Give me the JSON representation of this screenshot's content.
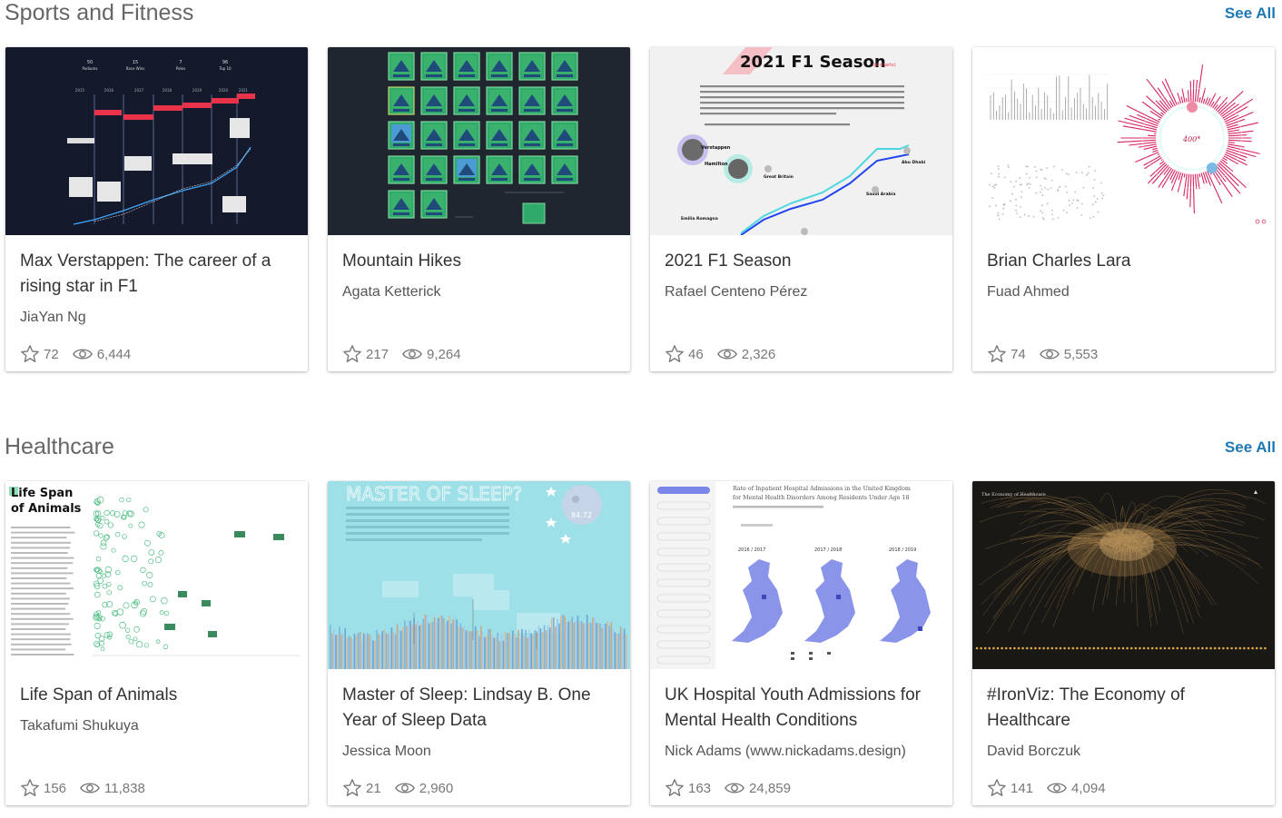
{
  "sections": [
    {
      "title": "Sports and Fitness",
      "see_all": "See All",
      "cards": [
        {
          "title": "Max Verstappen: The career of a rising star in F1",
          "author": "JiaYan Ng",
          "favorites": "72",
          "views": "6,444"
        },
        {
          "title": "Mountain Hikes",
          "author": "Agata Ketterick",
          "favorites": "217",
          "views": "9,264"
        },
        {
          "title": "2021 F1 Season",
          "author": "Rafael Centeno Pérez",
          "favorites": "46",
          "views": "2,326"
        },
        {
          "title": "Brian Charles Lara",
          "author": "Fuad Ahmed",
          "favorites": "74",
          "views": "5,553"
        }
      ]
    },
    {
      "title": "Healthcare",
      "see_all": "See All",
      "cards": [
        {
          "title": "Life Span of Animals",
          "author": "Takafumi Shukuya",
          "favorites": "156",
          "views": "11,838"
        },
        {
          "title": "Master of Sleep: Lindsay B. One Year of Sleep Data",
          "author": "Jessica Moon",
          "favorites": "21",
          "views": "2,960"
        },
        {
          "title": "UK Hospital Youth Admissions for Mental Health Conditions",
          "author": "Nick Adams (www.nickadams.design)",
          "favorites": "163",
          "views": "24,859"
        },
        {
          "title": "#IronViz: The Economy of Healthcare",
          "author": "David Borczuk",
          "favorites": "141",
          "views": "4,094"
        }
      ]
    }
  ],
  "thumbnails": {
    "verstappen": {
      "stats": [
        {
          "value": "50",
          "label": "Podiums"
        },
        {
          "value": "15",
          "label": "Race Wins"
        },
        {
          "value": "7",
          "label": "Poles"
        },
        {
          "value": "96",
          "label": "Top 10"
        }
      ],
      "years": [
        "2015",
        "2016",
        "2017",
        "2018",
        "2019",
        "2020",
        "2021"
      ]
    },
    "f1season": {
      "title": "2021 F1 Season",
      "subtitle": "(in charts)",
      "drivers": [
        "Verstappen",
        "Hamilton"
      ],
      "places": [
        "Great Britain",
        "Abu Dhabi",
        "Saudi Arabia",
        "Emilia Romagna"
      ]
    },
    "lifespan": {
      "title_line1": "Life Span",
      "title_line2": "of Animals"
    },
    "sleep": {
      "title": "MASTER OF SLEEP?",
      "score": "84.72"
    },
    "uk": {
      "title_line1": "Rate of Inpatient Hospital Admissions in the United Kingdom",
      "title_line2": "for Mental Health Disorders Among Residents Under Age 18",
      "years": [
        "2016 / 2017",
        "2017 / 2018",
        "2018 / 2019"
      ]
    },
    "iron": {
      "title": "The Economy of Healthcare"
    }
  },
  "icons": {
    "favorite": "star-icon",
    "views": "eye-icon"
  },
  "colors": {
    "link": "#1f77b4",
    "f1_red": "#e8334a",
    "night_bg": "#1f2630",
    "sleep_bg": "#9ee0e8"
  }
}
